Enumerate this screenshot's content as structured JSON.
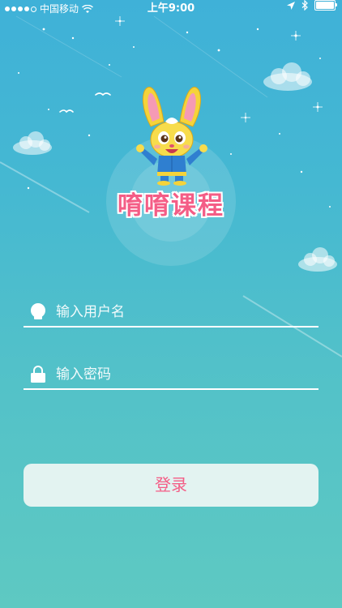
{
  "status_bar": {
    "carrier": "中国移动",
    "time": "上午9:00"
  },
  "app": {
    "title": "唷唷课程"
  },
  "form": {
    "username_placeholder": "输入用户名",
    "password_placeholder": "输入密码",
    "login_label": "登录"
  },
  "colors": {
    "accent": "#f45d86",
    "background_top": "#3fb1d8",
    "background_bottom": "#5ec9c2",
    "button_bg": "#e3f3f1"
  },
  "icons": {
    "username": "user-head-icon",
    "password": "lock-icon"
  }
}
